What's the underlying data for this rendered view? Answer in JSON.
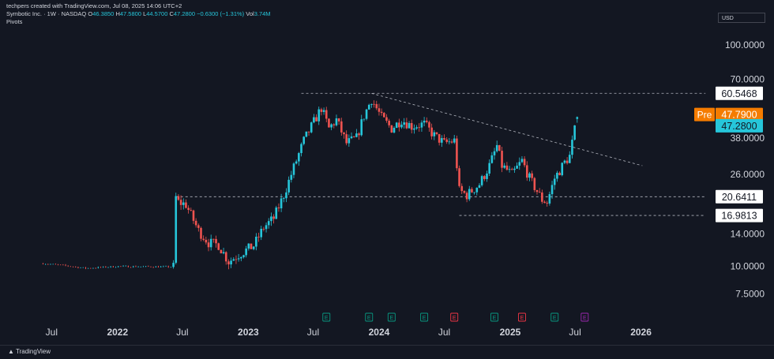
{
  "header": {
    "credit": "techpers created with TradingView.com, Jul 08, 2025 14:06 UTC+2",
    "symbol": "Symbotic Inc. · 1W · NASDAQ",
    "open_label": "O",
    "open": "46.3850",
    "high_label": "H",
    "high": "47.5800",
    "low_label": "L",
    "low": "44.5700",
    "close_label": "C",
    "close": "47.2800",
    "change": "−0.6300 (−1.31%)",
    "vol_label": "Vol",
    "vol": "3.74M",
    "indicator": "Pivots"
  },
  "currency": "USD",
  "footer": {
    "brand": "TradingView"
  },
  "colors": {
    "up": "#26c6da",
    "down": "#ef5350",
    "pre": "#f57c00",
    "background": "#131722",
    "earnings": "#089981",
    "earnings_miss": "#f23645",
    "earnings_next": "#9c27b0"
  },
  "chart_data": {
    "type": "candlestick",
    "y_scale": "log",
    "ylim": [
      6.5,
      125
    ],
    "xlim": [
      "2021-03-01",
      "2026-07-15"
    ],
    "y_ticks": [
      100,
      70,
      38,
      26,
      14,
      10,
      7.5
    ],
    "y_tick_labels": [
      "100.0000",
      "70.0000",
      "38.0000",
      "26.0000",
      "14.0000",
      "10.0000",
      "7.5000"
    ],
    "x_ticks": [
      {
        "label": "Jul",
        "date": "2021-07-01",
        "bold": false
      },
      {
        "label": "2022",
        "date": "2022-01-01",
        "bold": true
      },
      {
        "label": "Jul",
        "date": "2022-07-01",
        "bold": false
      },
      {
        "label": "2023",
        "date": "2023-01-01",
        "bold": true
      },
      {
        "label": "Jul",
        "date": "2023-07-01",
        "bold": false
      },
      {
        "label": "2024",
        "date": "2024-01-01",
        "bold": true
      },
      {
        "label": "Jul",
        "date": "2024-07-01",
        "bold": false
      },
      {
        "label": "2025",
        "date": "2025-01-01",
        "bold": true
      },
      {
        "label": "Jul",
        "date": "2025-07-01",
        "bold": false
      },
      {
        "label": "2026",
        "date": "2026-01-01",
        "bold": true
      }
    ],
    "price_labels": [
      {
        "value": 60.5468,
        "label": "60.5468",
        "style": "level"
      },
      {
        "value": 47.79,
        "label": "47.7900",
        "style": "pre",
        "tag": "Pre"
      },
      {
        "value": 47.28,
        "label": "47.2800",
        "style": "last"
      },
      {
        "value": 20.6411,
        "label": "20.6411",
        "style": "level"
      },
      {
        "value": 16.9813,
        "label": "16.9813",
        "style": "level"
      }
    ],
    "horizontal_lines": [
      {
        "value": 60.5468,
        "from": "2023-05-29",
        "to": "2026-06-30"
      },
      {
        "value": 20.6411,
        "from": "2022-06-13",
        "to": "2026-06-30"
      },
      {
        "value": 16.9813,
        "from": "2024-08-12",
        "to": "2026-06-30"
      }
    ],
    "trend_line": {
      "from": [
        "2023-12-11",
        60.5
      ],
      "to": [
        "2026-01-05",
        28.5
      ]
    },
    "earnings": [
      {
        "date": "2023-08-07",
        "label": "E",
        "kind": "beat"
      },
      {
        "date": "2023-12-04",
        "label": "E",
        "kind": "beat"
      },
      {
        "date": "2024-02-05",
        "label": "E",
        "kind": "beat"
      },
      {
        "date": "2024-05-06",
        "label": "E",
        "kind": "beat"
      },
      {
        "date": "2024-07-29",
        "label": "E",
        "kind": "miss"
      },
      {
        "date": "2024-11-18",
        "label": "E",
        "kind": "beat"
      },
      {
        "date": "2025-02-03",
        "label": "E",
        "kind": "miss"
      },
      {
        "date": "2025-05-05",
        "label": "E",
        "kind": "beat"
      },
      {
        "date": "2025-07-28",
        "label": "E",
        "kind": "next"
      }
    ],
    "anchors": [
      [
        "2021-06-07",
        10.3
      ],
      [
        "2021-08-02",
        10.1
      ],
      [
        "2021-10-04",
        9.8
      ],
      [
        "2022-01-03",
        10.0
      ],
      [
        "2022-05-02",
        9.95
      ],
      [
        "2022-06-06",
        9.95
      ],
      [
        "2022-06-13",
        20.5
      ],
      [
        "2022-06-20",
        19.5
      ],
      [
        "2022-07-11",
        19.0
      ],
      [
        "2022-08-15",
        14.5
      ],
      [
        "2022-09-12",
        12.8
      ],
      [
        "2022-10-10",
        12.5
      ],
      [
        "2022-11-07",
        10.5
      ],
      [
        "2022-12-05",
        11.3
      ],
      [
        "2023-01-16",
        12.4
      ],
      [
        "2023-02-13",
        15.0
      ],
      [
        "2023-03-13",
        16.5
      ],
      [
        "2023-04-10",
        21.0
      ],
      [
        "2023-05-08",
        28.0
      ],
      [
        "2023-06-05",
        37.0
      ],
      [
        "2023-07-03",
        45.0
      ],
      [
        "2023-07-24",
        52.0
      ],
      [
        "2023-08-14",
        42.0
      ],
      [
        "2023-09-04",
        46.0
      ],
      [
        "2023-10-02",
        36.0
      ],
      [
        "2023-10-30",
        38.0
      ],
      [
        "2023-11-20",
        48.0
      ],
      [
        "2023-12-11",
        57.0
      ],
      [
        "2024-01-08",
        47.0
      ],
      [
        "2024-02-05",
        42.0
      ],
      [
        "2024-03-04",
        46.0
      ],
      [
        "2024-04-01",
        43.0
      ],
      [
        "2024-05-06",
        44.0
      ],
      [
        "2024-06-03",
        39.0
      ],
      [
        "2024-07-01",
        36.0
      ],
      [
        "2024-07-29",
        37.0
      ],
      [
        "2024-08-12",
        22.0
      ],
      [
        "2024-09-02",
        21.0
      ],
      [
        "2024-10-07",
        23.5
      ],
      [
        "2024-11-04",
        28.5
      ],
      [
        "2024-11-25",
        35.0
      ],
      [
        "2024-12-09",
        28.5
      ],
      [
        "2025-01-06",
        26.0
      ],
      [
        "2025-02-03",
        30.0
      ],
      [
        "2025-02-24",
        25.0
      ],
      [
        "2025-03-31",
        20.0
      ],
      [
        "2025-04-14",
        19.5
      ],
      [
        "2025-05-05",
        25.0
      ],
      [
        "2025-06-02",
        29.5
      ],
      [
        "2025-06-16",
        31.5
      ],
      [
        "2025-07-07",
        47.28
      ]
    ]
  }
}
